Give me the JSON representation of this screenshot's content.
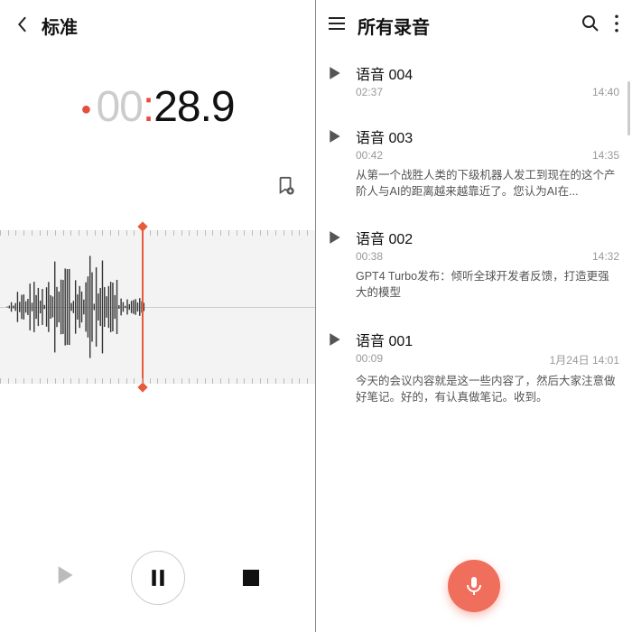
{
  "left": {
    "title": "标准",
    "timer_faded": "00",
    "timer_bold": "28.9"
  },
  "right": {
    "title": "所有录音",
    "items": [
      {
        "name": "语音 004",
        "dur": "02:37",
        "time": "14:40",
        "desc": ""
      },
      {
        "name": "语音 003",
        "dur": "00:42",
        "time": "14:35",
        "desc": "从第一个战胜人类的下级机器人发工到现在的这个产阶人与AI的距离越来越靠近了。您认为AI在..."
      },
      {
        "name": "语音 002",
        "dur": "00:38",
        "time": "14:32",
        "desc": "GPT4 Turbo发布：倾听全球开发者反馈，打造更强大的模型"
      },
      {
        "name": "语音 001",
        "dur": "00:09",
        "time": "1月24日 14:01",
        "desc": "今天的会议内容就是这一些内容了，然后大家注意做好笔记。好的，有认真做笔记。收到。"
      }
    ]
  }
}
